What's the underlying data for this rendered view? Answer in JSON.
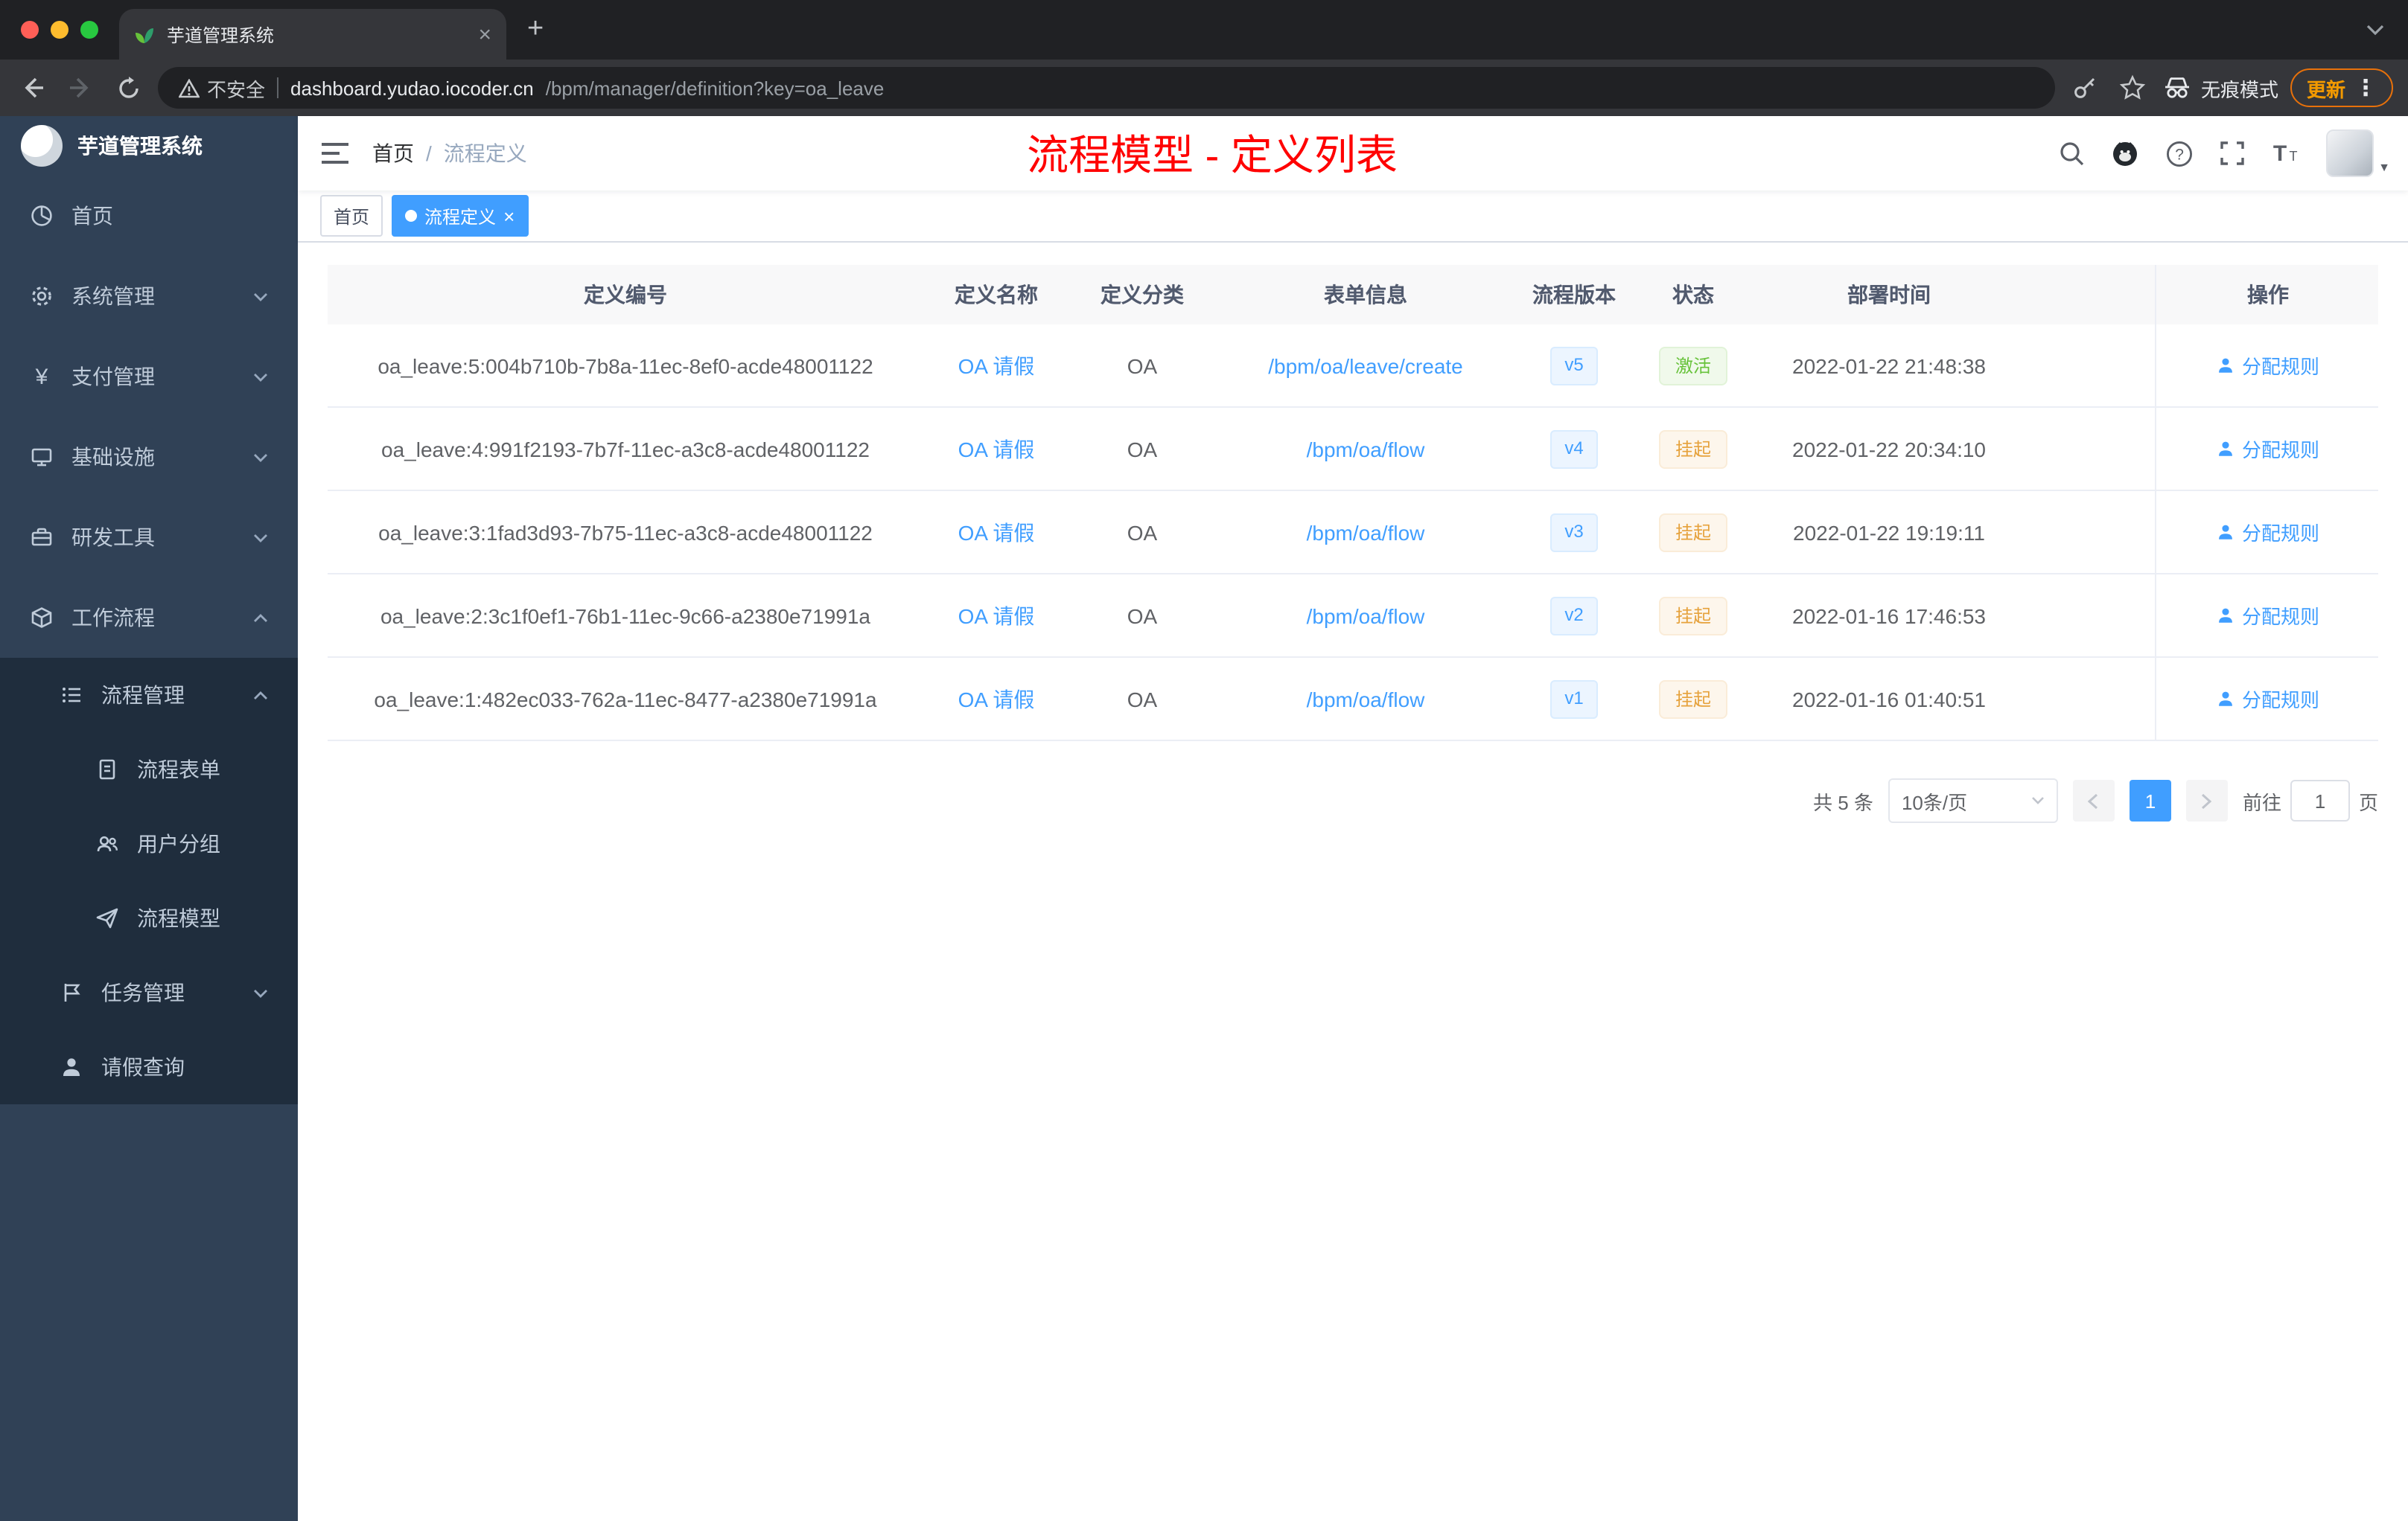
{
  "browser": {
    "tab": {
      "title": "芋道管理系统",
      "close": "×",
      "new_tab": "+"
    },
    "address": {
      "security_label": "不安全",
      "url_domain": "dashboard.yudao.iocoder.cn",
      "url_path": "/bpm/manager/definition?key=oa_leave",
      "incognito_label": "无痕模式",
      "update_label": "更新",
      "menu_dots": "⋮"
    }
  },
  "sidebar": {
    "title": "芋道管理系统",
    "items": [
      "首页",
      "系统管理",
      "支付管理",
      "基础设施",
      "研发工具",
      "工作流程"
    ],
    "process_group": {
      "label": "流程管理",
      "children": [
        "流程表单",
        "用户分组",
        "流程模型"
      ]
    },
    "task_label": "任务管理",
    "leave_label": "请假查询"
  },
  "header": {
    "breadcrumb_home": "首页",
    "breadcrumb_sep": "/",
    "breadcrumb_current": "流程定义",
    "page_title": "流程模型 - 定义列表"
  },
  "tags": {
    "home": "首页",
    "active": "流程定义",
    "close": "×"
  },
  "table": {
    "columns": [
      "定义编号",
      "定义名称",
      "定义分类",
      "表单信息",
      "流程版本",
      "状态",
      "部署时间",
      "操作"
    ],
    "rows": [
      {
        "id": "oa_leave:5:004b710b-7b8a-11ec-8ef0-acde48001122",
        "name": "OA 请假",
        "category": "OA",
        "form": "/bpm/oa/leave/create",
        "version": "v5",
        "status": "激活",
        "status_type": "success",
        "time": "2022-01-22 21:48:38",
        "action": "分配规则"
      },
      {
        "id": "oa_leave:4:991f2193-7b7f-11ec-a3c8-acde48001122",
        "name": "OA 请假",
        "category": "OA",
        "form": "/bpm/oa/flow",
        "version": "v4",
        "status": "挂起",
        "status_type": "warning",
        "time": "2022-01-22 20:34:10",
        "action": "分配规则"
      },
      {
        "id": "oa_leave:3:1fad3d93-7b75-11ec-a3c8-acde48001122",
        "name": "OA 请假",
        "category": "OA",
        "form": "/bpm/oa/flow",
        "version": "v3",
        "status": "挂起",
        "status_type": "warning",
        "time": "2022-01-22 19:19:11",
        "action": "分配规则"
      },
      {
        "id": "oa_leave:2:3c1f0ef1-76b1-11ec-9c66-a2380e71991a",
        "name": "OA 请假",
        "category": "OA",
        "form": "/bpm/oa/flow",
        "version": "v2",
        "status": "挂起",
        "status_type": "warning",
        "time": "2022-01-16 17:46:53",
        "action": "分配规则"
      },
      {
        "id": "oa_leave:1:482ec033-762a-11ec-8477-a2380e71991a",
        "name": "OA 请假",
        "category": "OA",
        "form": "/bpm/oa/flow",
        "version": "v1",
        "status": "挂起",
        "status_type": "warning",
        "time": "2022-01-16 01:40:51",
        "action": "分配规则"
      }
    ]
  },
  "pagination": {
    "total": "共 5 条",
    "page_size": "10条/页",
    "current_page": "1",
    "goto_label": "前往",
    "goto_value": "1",
    "unit_label": "页"
  },
  "colors": {
    "primary": "#409eff",
    "success": "#67c23a",
    "warning": "#e6a23c",
    "title_red": "#ff0000",
    "sidebar_bg": "#304156",
    "submenu_bg": "#1f2d3d"
  }
}
